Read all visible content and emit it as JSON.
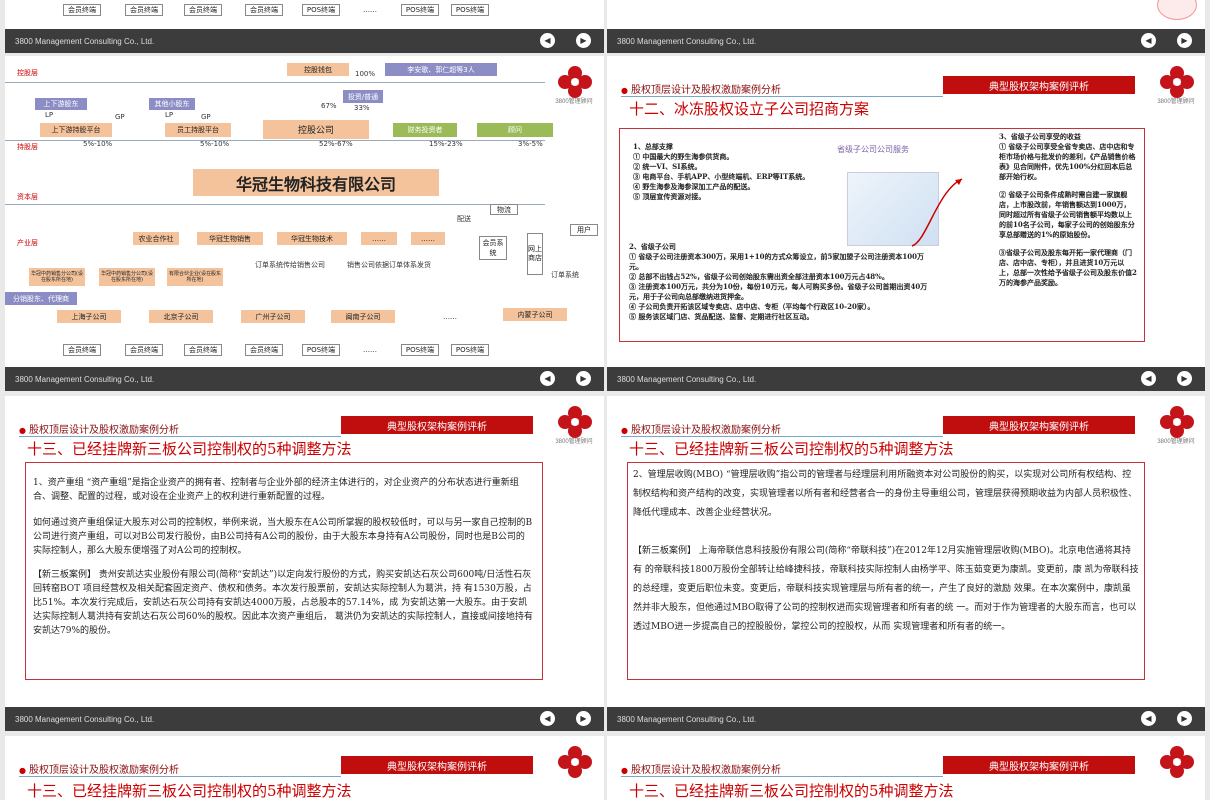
{
  "footer_text": "3800 Management Consulting Co., Ltd.",
  "prev_icon": "chevron-left-icon",
  "next_icon": "chevron-right-icon",
  "logo_text": "3800管理顾问",
  "logo_sub": "3800 Management Consulting",
  "header_left": "股权顶层设计及股权激励案例分析",
  "header_right": "典型股权架构案例评析",
  "top_strip": {
    "terminals": [
      "会员终端",
      "会员终端",
      "会员终端",
      "会员终端",
      "POS终端",
      "……",
      "POS终端",
      "POS终端"
    ]
  },
  "org": {
    "control_layer": "控股层",
    "hold_layer": "持股层",
    "capital_layer": "资本层",
    "industry_layer": "产业层",
    "holding_platform": "控股钱包",
    "pct100": "100%",
    "family": "李安歌、郭仁超等3人",
    "gp_box": "投资/普通",
    "pct67": "67%",
    "pct33": "33%",
    "upstream": "上下游股东",
    "other_small": "其他小股东",
    "lp": "LP",
    "gp": "GP",
    "up_platform": "上下游持股平台",
    "staff_platform": "员工持股平台",
    "holding_company": "控股公司",
    "fin_investor": "财务投资者",
    "advisor": "顾问",
    "p1": "5%-10%",
    "p2": "5%-10%",
    "p3": "52%-67%",
    "p4": "15%-23%",
    "p5": "3%-5%",
    "company": "华冠生物科技有限公司",
    "logistics": "物流",
    "delivery": "配送",
    "users": "用户",
    "member_system": "会员系统",
    "online_store": "网上商店",
    "order_system": "订单系统",
    "industry": [
      "农业合作社",
      "华冠生物销售",
      "华冠生物技术",
      "……",
      "……"
    ],
    "order_line1": "订单系统传给销售公司",
    "order_line2": "销售公司依据订单体系发货",
    "sub_small": [
      "华冠中药销售分公司(设在股东所在地)",
      "华冠中药销售分公司(设在股东所在地)",
      "有限合伙企业(设在股东所在地)"
    ],
    "distributor": "分销股东、代理商",
    "cities": [
      "上海子公司",
      "北京子公司",
      "广州子公司",
      "闽南子公司",
      "……",
      "内蒙子公司"
    ],
    "terminals": [
      "会员终端",
      "会员终端",
      "会员终端",
      "会员终端",
      "POS终端",
      "……",
      "POS终端",
      "POS终端"
    ]
  },
  "slide2": {
    "title": "十二、冰冻股权设立子公司招商方案",
    "caption": "省级子公司公司服务",
    "s1": [
      "1、总部支撑",
      "① 中国最大的野生海参供货商。",
      "② 统一VI、SI系统。",
      "③ 电商平台、手机APP、小型终端机、ERP等IT系统。",
      "④ 野生海参及海参深加工产品的配送。",
      "⑤ 顶层宣传资源对接。"
    ],
    "s2": [
      "2、省级子公司",
      "① 省级子公司注册资本300万，采用1+10的方式众筹设立，前5家加盟子公司注册资本100万元。",
      "② 总部不出钱占52%，省级子公司创始股东需出资全部注册资本100万元占48%。",
      "③ 注册资本100万元，共分为10份，每份10万元，每人可购买多份。省级子公司首期出资40万元，用于子公司向总部缴纳进货押金。",
      "④ 子公司负责开拓该区域专卖店、店中店、专柜（平均每个行政区10-20家）。",
      "⑤ 服务该区域门店、货品配送、监督、定期进行社区互动。"
    ],
    "s3": [
      "3、省级子公司享受的收益",
      "① 省级子公司享受全省专卖店、店中店和专柜市场价格与批发价的差利，《产品销售价格表》见合同附件，优先100%分红回本后总部开始行权。",
      "② 省级子公司条件成熟时需自建一家旗舰店，上市股改前，年销售额达到1000万，同时超过所有省级子公司销售额平均数以上的前10名子公司，每家子公司的创始股东分享总部赠送的1%的原始股份。",
      "③省级子公司及股东每开拓一家代理商（门店、店中店、专柜），并且进货10万元以上，总部一次性给予省级子公司及股东价值2万的海参产品奖励。"
    ]
  },
  "slide3": {
    "title": "十三、已经挂牌新三板公司控制权的5种调整方法",
    "p1": "1、资产重组 “资产重组”是指企业资产的拥有者、控制者与企业外部的经济主体进行的，对企业资产的分布状态进行重新组 合、调整、配置的过程，或对设在企业资产上的权利进行重新配置的过程。",
    "p2": "如何通过资产重组保证大股东对公司的控制权，举例来说，当大股东在A公司所掌握的股权较低时，可以与另一家自己控制的B公司进行资产重组，可以对B公司发行股份，由B公司持有A公司的股份，由于大股东本身持有A公司股份，同时也是B公司的实际控制人，那么大股东便增强了对A公司的控制权。",
    "p3": "【新三板案例】 贵州安凯达实业股份有限公司(简称“安凯达”)以定向发行股份的方式，购买安凯达石灰公司600吨/日活性石灰 回转窑BOT 项目经营权及相关配套固定资产、债权和债务。本次发行股票前，安凯达实际控制人为葛洪，持 有1530万股，占比51%。本次发行完成后，安凯达石灰公司持有安凯达4000万股，占总股本的57.14%，成 为安凯达第一大股东。由于安凯达实际控制人葛洪持有安凯达石灰公司60%的股权。因此本次资产重组后， 葛洪仍为安凯达的实际控制人，直接或间接地持有安凯达79%的股份。"
  },
  "slide4": {
    "title": "十三、已经挂牌新三板公司控制权的5种调整方法",
    "p1": "2、管理层收购(MBO) “管理层收购”指公司的管理者与经理层利用所融资本对公司股份的购买，以实现对公司所有权结构、控制权结构和资产结构的改变，实现管理者以所有者和经营者合一的身份主导重组公司，管理层获得预期收益为内部人员积极性、降低代理成本、改善企业经营状况。",
    "p2": "【新三板案例】 上海帝联信息科技股份有限公司(简称“帝联科技”)在2012年12月实施管理层收购(MBO)。北京电信通将其持有 的帝联科技1800万股份全部转让给峰捷科技，帝联科技实际控制人由杨学平、陈玉茹变更为康凯。变更前，康 凯为帝联科技的总经理，变更后职位未变。变更后，帝联科技实现管理层与所有者的统一，产生了良好的激励 效果。在本次案例中，康凯虽然并非大股东，但他通过MBO取得了公司的控制权进而实现管理者和所有者的统 一。而对于作为管理者的大股东而言，也可以透过MBO进一步提高自己的控股股份，掌控公司的控股权，从而 实现管理者和所有者的统一。"
  },
  "slide5": {
    "title": "十三、已经挂牌新三板公司控制权的5种调整方法"
  },
  "slide6": {
    "title": "十三、已经挂牌新三板公司控制权的5种调整方法"
  }
}
